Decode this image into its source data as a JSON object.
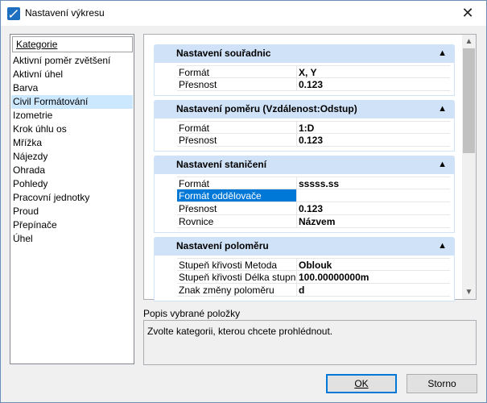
{
  "window": {
    "title": "Nastavení výkresu",
    "close_icon": "close-icon"
  },
  "categories": {
    "header": "Kategorie",
    "items": [
      "Aktivní poměr zvětšení",
      "Aktivní úhel",
      "Barva",
      "Civil Formátování",
      "Izometrie",
      "Krok úhlu os",
      "Mřížka",
      "Nájezdy",
      "Ohrada",
      "Pohledy",
      "Pracovní jednotky",
      "Proud",
      "Přepínače",
      "Úhel"
    ],
    "selected": "Civil Formátování"
  },
  "groups": [
    {
      "title": "Nastavení souřadnic",
      "rows": [
        {
          "name": "Formát",
          "value": "X, Y"
        },
        {
          "name": "Přesnost",
          "value": "0.123"
        }
      ]
    },
    {
      "title": "Nastavení poměru (Vzdálenost:Odstup)",
      "rows": [
        {
          "name": "Formát",
          "value": "1:D"
        },
        {
          "name": "Přesnost",
          "value": "0.123"
        }
      ]
    },
    {
      "title": "Nastavení staničení",
      "rows": [
        {
          "name": "Formát",
          "value": "sssss.ss"
        },
        {
          "name": "Formát oddělovače",
          "value": ""
        },
        {
          "name": "Přesnost",
          "value": "0.123"
        },
        {
          "name": "Rovnice",
          "value": "Názvem"
        }
      ]
    },
    {
      "title": "Nastavení poloměru",
      "rows": [
        {
          "name": "Stupeň křivosti Metoda",
          "value": "Oblouk"
        },
        {
          "name": "Stupeň křivosti Délka stupně",
          "value": "100.00000000m"
        },
        {
          "name": "Znak změny poloměru",
          "value": "d"
        }
      ]
    }
  ],
  "description": {
    "label": "Popis vybrané položky",
    "text": "Zvolte kategorii, kterou chcete prohlédnout."
  },
  "buttons": {
    "ok": "OK",
    "cancel": "Storno"
  }
}
